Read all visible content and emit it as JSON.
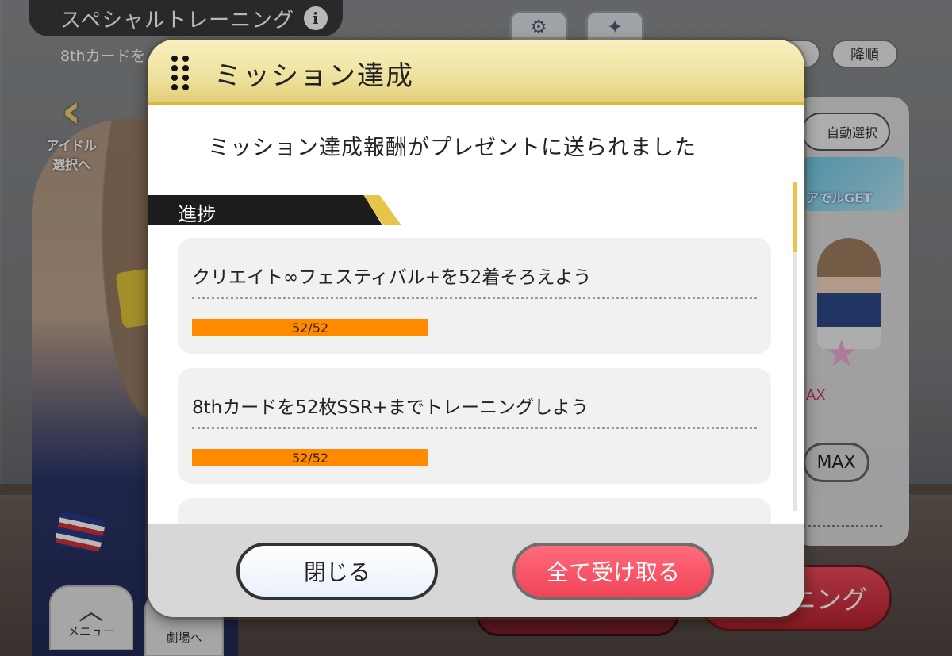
{
  "background": {
    "screen_title": "スペシャルトレーニング",
    "info_icon": "i",
    "subtitle": "8thカードを",
    "sort_order": "降順",
    "left_nav_label_1": "アイドル",
    "left_nav_label_2": "選択へ",
    "auto_select": "自動選択",
    "banner_text": "アでルGET",
    "level_text": "AX",
    "max_label": "MAX",
    "training_button": "ニング",
    "menu_label": "メニュー",
    "theater_label": "劇場へ",
    "icons": [
      "gear-icon",
      "sparkle-icon",
      "chevron-left-icon",
      "chevron-up-icon"
    ]
  },
  "modal": {
    "title": "ミッション達成",
    "message": "ミッション達成報酬がプレゼントに送られました",
    "section_label": "進捗",
    "missions": [
      {
        "text": "クリエイト∞フェスティバル+を52着そろえよう",
        "progress": "52/52",
        "fraction": 1.0
      },
      {
        "text": "8thカードを52枚SSR+までトレーニングしよう",
        "progress": "52/52",
        "fraction": 1.0
      }
    ],
    "close_button": "閉じる",
    "receive_all_button": "全て受け取る"
  },
  "colors": {
    "header_gold": "#efe2a0",
    "accent_gold": "#e6c64a",
    "progress_orange": "#ff8a00",
    "receive_red": "#f04458"
  }
}
